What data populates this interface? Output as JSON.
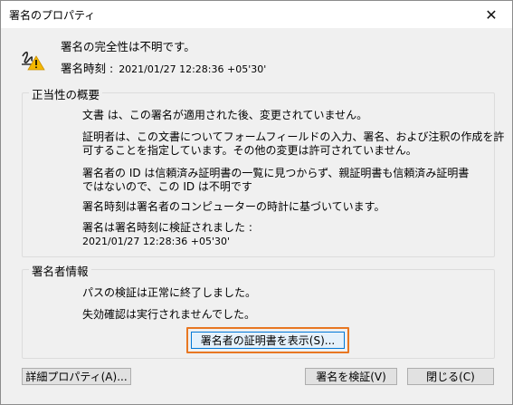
{
  "window": {
    "title": "署名のプロパティ",
    "close_glyph": "✕"
  },
  "status": {
    "integrity": "署名の完全性は不明です。",
    "time_label": "署名時刻 :",
    "time_value": "2021/01/27 12:28:36 +05'30'"
  },
  "validity": {
    "legend": "正当性の概要",
    "line1": "文書 は、この署名が適用された後、変更されていません。",
    "line2a": "証明者は、この文書についてフォームフィールドの入力、署名、および注釈の作成を許",
    "line2b": "可することを指定しています。その他の変更は許可されていません。",
    "line3a": "署名者の ID は信頼済み証明書の一覧に見つからず、親証明書も信頼済み証明書",
    "line3b": "ではないので、この ID は不明です",
    "line4": "署名時刻は署名者のコンピューターの時計に基づいています。",
    "line5": "署名は署名時刻に検証されました :",
    "line5_time": "2021/01/27 12:28:36 +05'30'"
  },
  "signer": {
    "legend": "署名者情報",
    "line1": "パスの検証は正常に終了しました。",
    "line2": "失効確認は実行されませんでした。",
    "show_cert_button": "署名者の証明書を表示(S)..."
  },
  "buttons": {
    "advanced": "詳細プロパティ(A)...",
    "validate": "署名を検証(V)",
    "close": "閉じる(C)"
  },
  "colors": {
    "focus_ring": "#e87722",
    "warning": "#f5b800"
  }
}
